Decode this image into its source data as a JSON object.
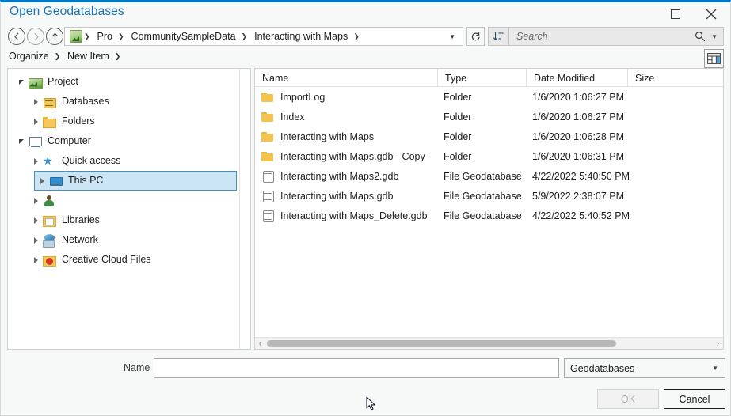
{
  "window": {
    "title": "Open Geodatabases",
    "accent_color": "#0078c8",
    "controls": {
      "maximize": "maximize-button",
      "close": "close-button"
    }
  },
  "navbar": {
    "back": "back-icon",
    "forward": "forward-icon",
    "up": "up-icon",
    "root_icon": "project-icon",
    "breadcrumbs": [
      {
        "label": "Pro"
      },
      {
        "label": "CommunitySampleData"
      },
      {
        "label": "Interacting with Maps"
      }
    ],
    "path_dropdown_caret": "▼",
    "refresh": "refresh-icon",
    "sort": "sort-icon",
    "search": {
      "placeholder": "Search",
      "value": "",
      "icon": "search-icon",
      "caret": "⌄"
    }
  },
  "organize_bar": {
    "organize_label": "Organize",
    "new_item_label": "New Item",
    "view_mode_icon": "details-view-icon"
  },
  "tree": {
    "items": [
      {
        "label": "Project",
        "icon": "project-icon",
        "state": "expanded",
        "indent": 0,
        "selected": false
      },
      {
        "label": "Databases",
        "icon": "databases-icon",
        "state": "collapsed",
        "indent": 1,
        "selected": false
      },
      {
        "label": "Folders",
        "icon": "folder-icon",
        "state": "collapsed",
        "indent": 1,
        "selected": false
      },
      {
        "label": "Computer",
        "icon": "computer-icon",
        "state": "expanded",
        "indent": 0,
        "selected": false
      },
      {
        "label": "Quick access",
        "icon": "star-icon",
        "state": "collapsed",
        "indent": 1,
        "selected": false
      },
      {
        "label": "This PC",
        "icon": "this-pc-icon",
        "state": "collapsed",
        "indent": 1,
        "selected": true
      },
      {
        "label": "",
        "icon": "user-icon",
        "state": "collapsed",
        "indent": 1,
        "selected": false
      },
      {
        "label": "Libraries",
        "icon": "libraries-icon",
        "state": "collapsed",
        "indent": 1,
        "selected": false
      },
      {
        "label": "Network",
        "icon": "network-icon",
        "state": "collapsed",
        "indent": 1,
        "selected": false
      },
      {
        "label": "Creative Cloud Files",
        "icon": "creative-cloud-icon",
        "state": "collapsed",
        "indent": 1,
        "selected": false
      }
    ]
  },
  "file_list": {
    "columns": [
      "Name",
      "Type",
      "Date Modified",
      "Size"
    ],
    "rows": [
      {
        "name": "ImportLog",
        "type": "Folder",
        "date": "1/6/2020 1:06:27 PM",
        "size": "",
        "icon": "folder-icon"
      },
      {
        "name": "Index",
        "type": "Folder",
        "date": "1/6/2020 1:06:27 PM",
        "size": "",
        "icon": "folder-icon"
      },
      {
        "name": "Interacting with Maps",
        "type": "Folder",
        "date": "1/6/2020 1:06:28 PM",
        "size": "",
        "icon": "folder-icon"
      },
      {
        "name": "Interacting with Maps.gdb - Copy",
        "type": "Folder",
        "date": "1/6/2020 1:06:31 PM",
        "size": "",
        "icon": "folder-icon"
      },
      {
        "name": "Interacting with Maps2.gdb",
        "type": "File Geodatabase",
        "date": "4/22/2022 5:40:50 PM",
        "size": "",
        "icon": "geodatabase-icon"
      },
      {
        "name": "Interacting with Maps.gdb",
        "type": "File Geodatabase",
        "date": "5/9/2022 2:38:07 PM",
        "size": "",
        "icon": "geodatabase-icon"
      },
      {
        "name": "Interacting with Maps_Delete.gdb",
        "type": "File Geodatabase",
        "date": "4/22/2022 5:40:52 PM",
        "size": "",
        "icon": "geodatabase-icon"
      }
    ],
    "hscroll": {
      "left_arrow": "‹",
      "right_arrow": "›"
    }
  },
  "footer": {
    "name_label": "Name",
    "name_value": "",
    "name_placeholder": "",
    "type_filter": "Geodatabases",
    "ok_label": "OK",
    "ok_enabled": false,
    "cancel_label": "Cancel"
  }
}
